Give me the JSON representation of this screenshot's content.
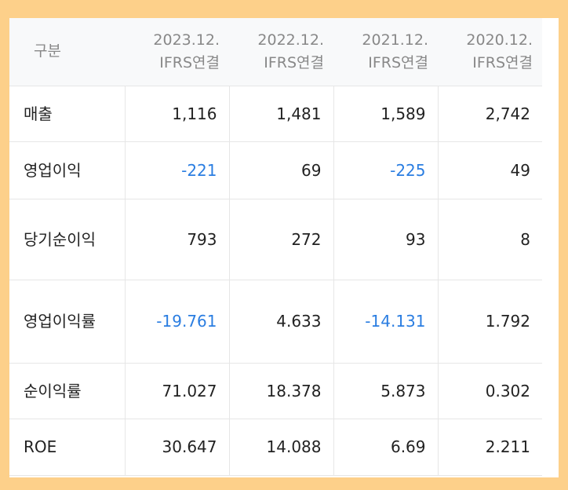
{
  "table": {
    "header": {
      "label": "구분",
      "columns": [
        {
          "line1": "2023.12.",
          "line2": "IFRS연결"
        },
        {
          "line1": "2022.12.",
          "line2": "IFRS연결"
        },
        {
          "line1": "2021.12.",
          "line2": "IFRS연결"
        },
        {
          "line1": "2020.12.",
          "line2": "IFRS연결"
        }
      ]
    },
    "rows": [
      {
        "label": "매출",
        "values": [
          "1,116",
          "1,481",
          "1,589",
          "2,742"
        ]
      },
      {
        "label": "영업이익",
        "values": [
          "-221",
          "69",
          "-225",
          "49"
        ]
      },
      {
        "label": "당기순이익",
        "values": [
          "793",
          "272",
          "93",
          "8"
        ]
      },
      {
        "label": "영업이익률",
        "values": [
          "-19.761",
          "4.633",
          "-14.131",
          "1.792"
        ]
      },
      {
        "label": "순이익률",
        "values": [
          "71.027",
          "18.378",
          "5.873",
          "0.302"
        ]
      },
      {
        "label": "ROE",
        "values": [
          "30.647",
          "14.088",
          "6.69",
          "2.211"
        ]
      }
    ],
    "negative_color": "#2a7de1",
    "frame_color": "#fdd08a"
  }
}
